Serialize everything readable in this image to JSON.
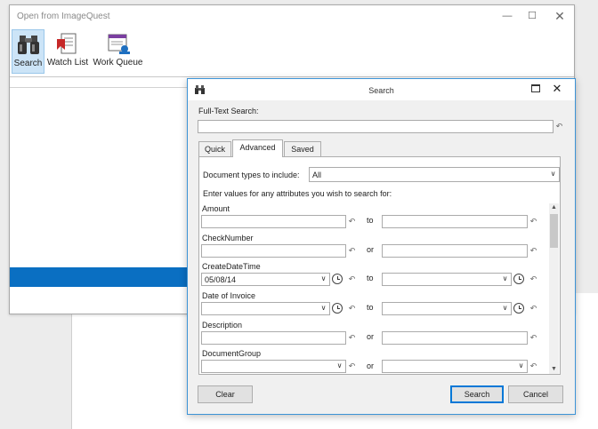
{
  "outer_window": {
    "title": "Open from ImageQuest",
    "ribbon": [
      {
        "label": "Search",
        "icon": "binoculars-icon"
      },
      {
        "label": "Watch List",
        "icon": "watch-list-icon"
      },
      {
        "label": "Work Queue",
        "icon": "work-queue-icon"
      }
    ]
  },
  "dialog": {
    "title": "Search",
    "fulltext_label": "Full-Text Search:",
    "fulltext_value": "",
    "tabs": [
      "Quick",
      "Advanced",
      "Saved"
    ],
    "active_tab": "Advanced",
    "doctype_label": "Document types to include:",
    "doctype_value": "All",
    "instruction": "Enter values for any attributes you wish to search for:",
    "attributes": [
      {
        "name": "Amount",
        "connector": "to",
        "from": "",
        "to": ""
      },
      {
        "name": "CheckNumber",
        "connector": "or",
        "from": "",
        "to": ""
      },
      {
        "name": "CreateDateTime",
        "connector": "to",
        "from": "05/08/14",
        "to": ""
      },
      {
        "name": "Date of Invoice",
        "connector": "to",
        "from": "",
        "to": ""
      },
      {
        "name": "Description",
        "connector": "or",
        "from": "",
        "to": ""
      },
      {
        "name": "DocumentGroup",
        "connector": "or",
        "from": "",
        "to": ""
      }
    ],
    "buttons": {
      "clear": "Clear",
      "search": "Search",
      "cancel": "Cancel"
    }
  },
  "colors": {
    "accent": "#0a6fc2",
    "dialog_border": "#3c93d6",
    "ribbon_active": "#cce4f7"
  }
}
